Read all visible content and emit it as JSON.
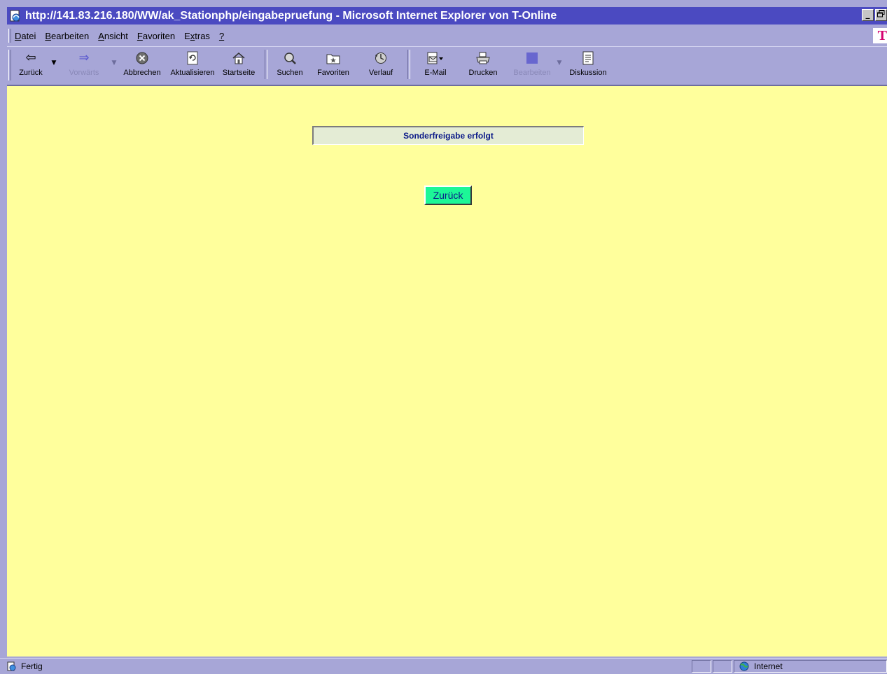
{
  "window": {
    "title": "http://141.83.216.180/WW/ak_Stationphp/eingabepruefung - Microsoft Internet Explorer von T-Online",
    "controls": {
      "minimize": "_",
      "restore": "🗗"
    }
  },
  "menu": {
    "items": [
      {
        "key": "D",
        "rest": "atei"
      },
      {
        "key": "B",
        "rest": "earbeiten"
      },
      {
        "key": "A",
        "rest": "nsicht"
      },
      {
        "key": "F",
        "rest": "avoriten"
      },
      {
        "pre": "E",
        "key": "x",
        "rest": "tras"
      },
      {
        "key": "?",
        "rest": ""
      }
    ],
    "brand_letter": "T"
  },
  "toolbar": {
    "back": "Zurück",
    "forward": "Vorwärts",
    "stop": "Abbrechen",
    "refresh": "Aktualisieren",
    "home": "Startseite",
    "search": "Suchen",
    "favorites": "Favoriten",
    "history": "Verlauf",
    "mail": "E-Mail",
    "print": "Drucken",
    "edit": "Bearbeiten",
    "discuss": "Diskussion"
  },
  "content": {
    "message": "Sonderfreigabe erfolgt",
    "back_button": "Zurück",
    "background": "#ffff9c",
    "button_color": "#1cf797",
    "text_color": "#0b1a88"
  },
  "status": {
    "text": "Fertig",
    "zone": "Internet"
  },
  "colors": {
    "titlebar": "#4b4ac1",
    "chrome": "#a7a6d7",
    "brand": "#d4006f"
  }
}
